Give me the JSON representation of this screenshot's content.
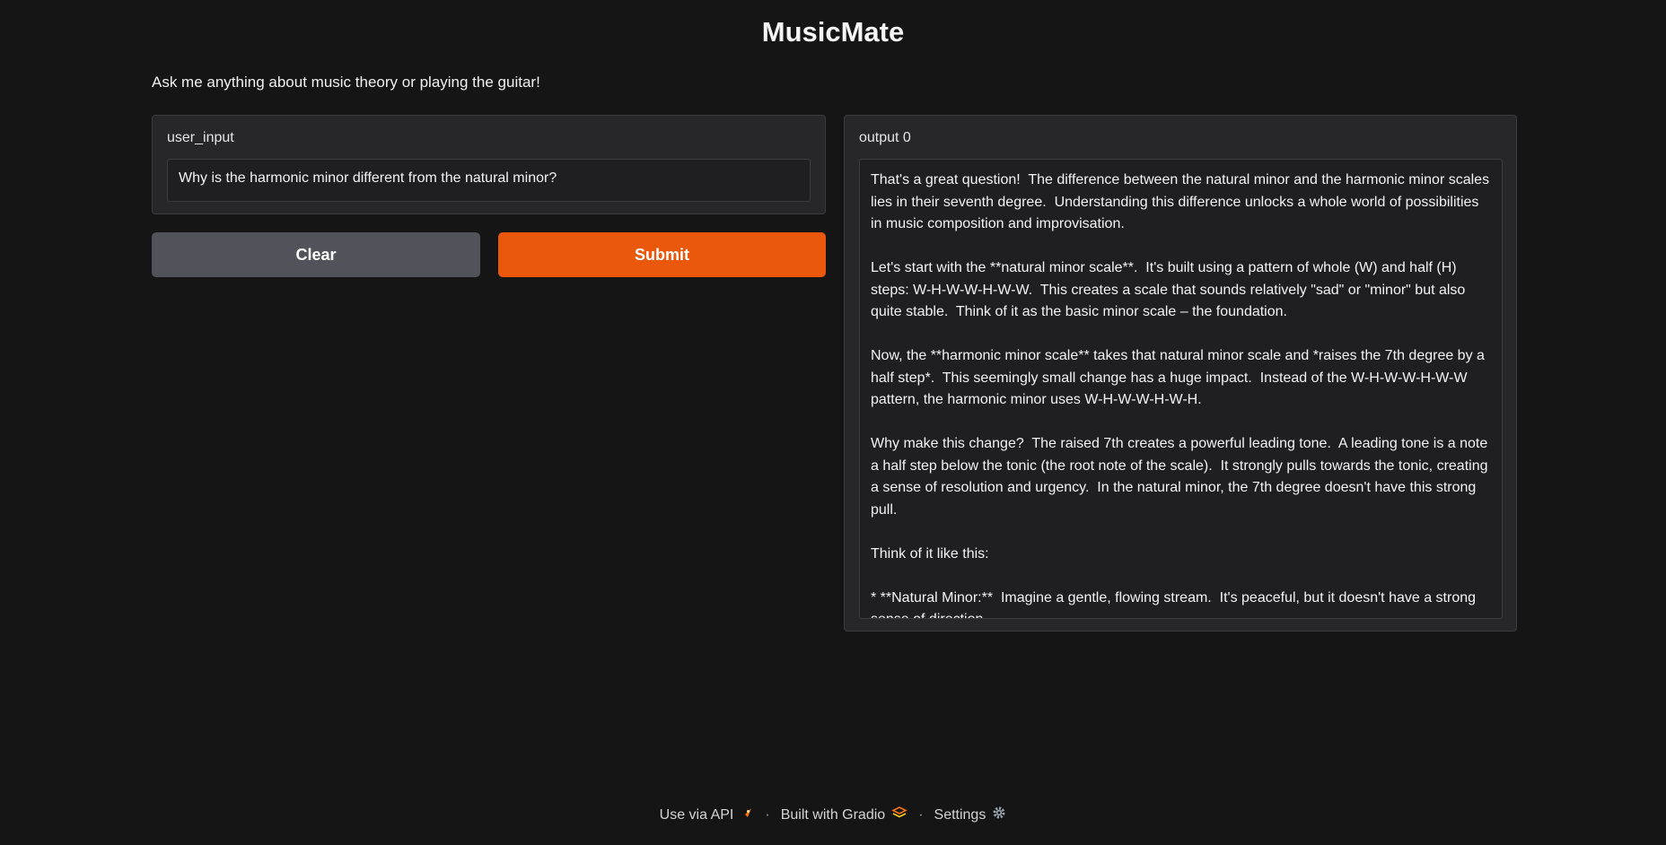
{
  "app": {
    "title": "MusicMate",
    "description": "Ask me anything about music theory or playing the guitar!"
  },
  "input_panel": {
    "label": "user_input",
    "value": "Why is the harmonic minor different from the natural minor?"
  },
  "buttons": {
    "clear_label": "Clear",
    "submit_label": "Submit"
  },
  "output_panel": {
    "label": "output 0",
    "paragraphs": [
      "That's a great question!  The difference between the natural minor and the harmonic minor scales lies in their seventh degree.  Understanding this difference unlocks a whole world of possibilities in music composition and improvisation.",
      "Let's start with the **natural minor scale**.  It's built using a pattern of whole (W) and half (H) steps: W-H-W-W-H-W-W.  This creates a scale that sounds relatively \"sad\" or \"minor\" but also quite stable.  Think of it as the basic minor scale – the foundation.",
      "Now, the **harmonic minor scale** takes that natural minor scale and *raises the 7th degree by a half step*.  This seemingly small change has a huge impact.  Instead of the W-H-W-W-H-W-W pattern, the harmonic minor uses W-H-W-W-H-W-H.",
      "Why make this change?  The raised 7th creates a powerful leading tone.  A leading tone is a note a half step below the tonic (the root note of the scale).  It strongly pulls towards the tonic, creating a sense of resolution and urgency.  In the natural minor, the 7th degree doesn't have this strong pull.",
      "Think of it like this:",
      "* **Natural Minor:**  Imagine a gentle, flowing stream.  It's peaceful, but it doesn't have a strong sense of direction."
    ]
  },
  "footer": {
    "api_label": "Use via API",
    "built_label": "Built with Gradio",
    "settings_label": "Settings",
    "separator": "·"
  },
  "colors": {
    "background": "#151515",
    "panel": "#272729",
    "clear_button": "#52525b",
    "submit_button": "#ea580c"
  }
}
